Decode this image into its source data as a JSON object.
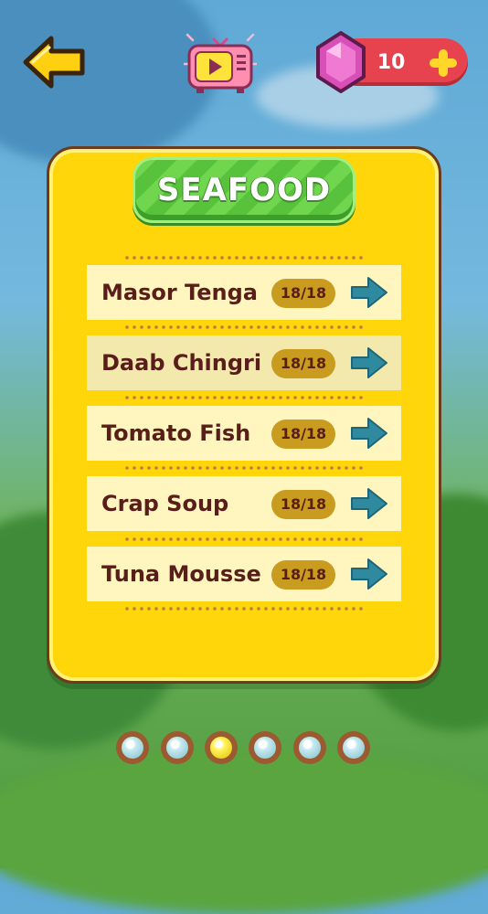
{
  "header": {
    "gem_count": "10"
  },
  "panel": {
    "title": "SEAFOOD",
    "items": [
      {
        "label": "Masor Tenga",
        "progress": "18/18"
      },
      {
        "label": "Daab Chingri",
        "progress": "18/18"
      },
      {
        "label": "Tomato Fish",
        "progress": "18/18"
      },
      {
        "label": "Crap Soup",
        "progress": "18/18"
      },
      {
        "label": "Tuna Mousse",
        "progress": "18/18"
      }
    ],
    "selected_index": 1
  },
  "pager": {
    "count": 6,
    "active_index": 2
  },
  "colors": {
    "panel": "#ffd60a",
    "title_badge": "#58c23c",
    "gem_pill": "#e6434f",
    "arrow": "#2f8aa0",
    "text": "#5a1e1a"
  },
  "icons": {
    "back": "back-arrow-icon",
    "video": "tv-video-icon",
    "gem": "gem-icon",
    "plus": "plus-icon",
    "row_arrow": "arrow-right-icon"
  }
}
